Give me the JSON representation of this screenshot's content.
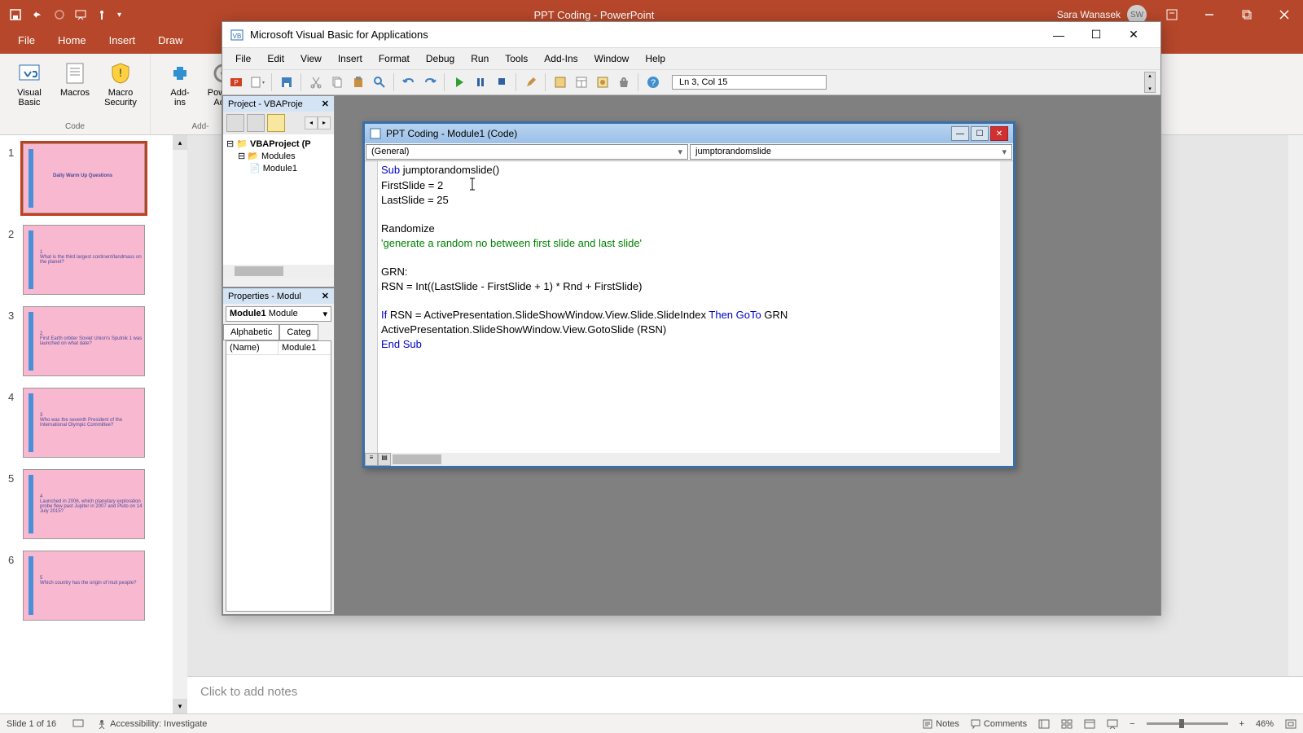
{
  "powerpoint": {
    "app_title": "PPT Coding  -  PowerPoint",
    "user_name": "Sara Wanasek",
    "user_initials": "SW",
    "ribbon_tabs": {
      "file": "File",
      "home": "Home",
      "insert": "Insert",
      "draw": "Draw"
    },
    "ribbon_items": {
      "visual_basic": "Visual\nBasic",
      "macros": "Macros",
      "macro_security": "Macro\nSecurity",
      "addins": "Add-\nins",
      "powerp_addins": "PowerP\nAdd-",
      "group_code": "Code",
      "group_addins": "Add-"
    },
    "notes_placeholder": "Click to add notes",
    "status": {
      "slide_counter": "Slide 1 of 16",
      "accessibility": "Accessibility: Investigate",
      "notes_btn": "Notes",
      "comments_btn": "Comments",
      "zoom": "46%"
    },
    "thumbnails": [
      {
        "n": "1",
        "txt": "Daily Warm Up Questions"
      },
      {
        "n": "2",
        "txt": "1\nWhat is the third largest continent/landmass on the planet?"
      },
      {
        "n": "3",
        "txt": "2\nFirst Earth orbiter Soviet Union's Sputnik 1 was launched on what date?"
      },
      {
        "n": "4",
        "txt": "3\nWho was the seventh President of the International Olympic Committee?"
      },
      {
        "n": "5",
        "txt": "4\nLaunched in 2006, which planetary exploration probe flew past Jupiter in 2007 and Pluto on 14 July 2015?"
      },
      {
        "n": "6",
        "txt": "5\nWhich country has the origin of Inuit people?"
      }
    ]
  },
  "vba": {
    "window_title": "Microsoft Visual Basic for Applications",
    "menus": {
      "file": "File",
      "edit": "Edit",
      "view": "View",
      "insert": "Insert",
      "format": "Format",
      "debug": "Debug",
      "run": "Run",
      "tools": "Tools",
      "addins": "Add-Ins",
      "window": "Window",
      "help": "Help"
    },
    "lncol": "Ln 3, Col 15",
    "project_panel": {
      "title": "Project - VBAProje",
      "root": "VBAProject (P",
      "folder": "Modules",
      "module": "Module1"
    },
    "props_panel": {
      "title": "Properties - Modul",
      "combo_name": "Module1",
      "combo_type": "Module",
      "tab_alpha": "Alphabetic",
      "tab_categ": "Categ",
      "row_name_k": "(Name)",
      "row_name_v": "Module1"
    },
    "code_window": {
      "title": "PPT Coding - Module1 (Code)",
      "dd_left": "(General)",
      "dd_right": "jumptorandomslide"
    },
    "code": {
      "l1_kw": "Sub ",
      "l1_rest": "jumptorandomslide()",
      "l2": "FirstSlide = 2",
      "l3": "LastSlide = 25",
      "l5": "Randomize",
      "l6": "'generate a random no between first slide and last slide'",
      "l8": "GRN:",
      "l9": "RSN = Int((LastSlide - FirstSlide + 1) * Rnd + FirstSlide)",
      "l11a": "If",
      "l11b": " RSN = ActivePresentation.SlideShowWindow.View.Slide.SlideIndex ",
      "l11c": "Then GoTo",
      "l11d": " GRN",
      "l12": "ActivePresentation.SlideShowWindow.View.GotoSlide (RSN)",
      "l13": "End Sub"
    }
  }
}
